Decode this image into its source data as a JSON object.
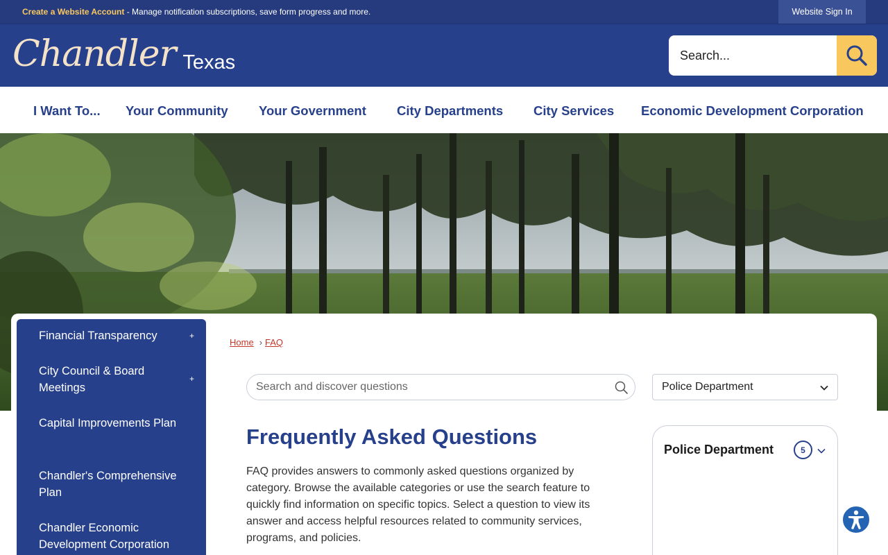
{
  "topbar": {
    "create_account_link": "Create a Website Account",
    "message": " - Manage notification subscriptions, save form progress and more.",
    "sign_in_label": "Website Sign In"
  },
  "header": {
    "logo_script": "Chandler",
    "logo_state": "Texas",
    "search_placeholder": "Search...",
    "search_icon": "search-icon"
  },
  "nav": {
    "items": [
      {
        "label": "I Want To..."
      },
      {
        "label": "Your Community"
      },
      {
        "label": "Your Government"
      },
      {
        "label": "City Departments"
      },
      {
        "label": "City Services"
      },
      {
        "label": "Economic Development Corporation"
      }
    ]
  },
  "sidebar": {
    "items": [
      {
        "label": "Financial Transparency",
        "expand": "+"
      },
      {
        "label": "City Council & Board Meetings",
        "expand": "+"
      },
      {
        "label": "Capital Improvements Plan"
      },
      {
        "label": "Chandler's Comprehensive Plan"
      },
      {
        "label": "Chandler Economic Development Corporation"
      }
    ]
  },
  "breadcrumb": {
    "home": "Home",
    "separator": "›",
    "current": "FAQ"
  },
  "faq": {
    "search_placeholder": "Search and discover questions",
    "category_select": "Police Department",
    "title": "Frequently Asked Questions",
    "description": "FAQ provides answers to commonly asked questions organized by category. Browse the available categories or use the search feature to quickly find information on specific topics. Select a question to view its answer and access helpful resources related to community services, programs, and policies."
  },
  "category_card": {
    "name": "Police Department",
    "count": "5"
  },
  "colors": {
    "brand_blue": "#27408b",
    "accent_gold": "#f8c85e",
    "link_red": "#c0392b"
  }
}
